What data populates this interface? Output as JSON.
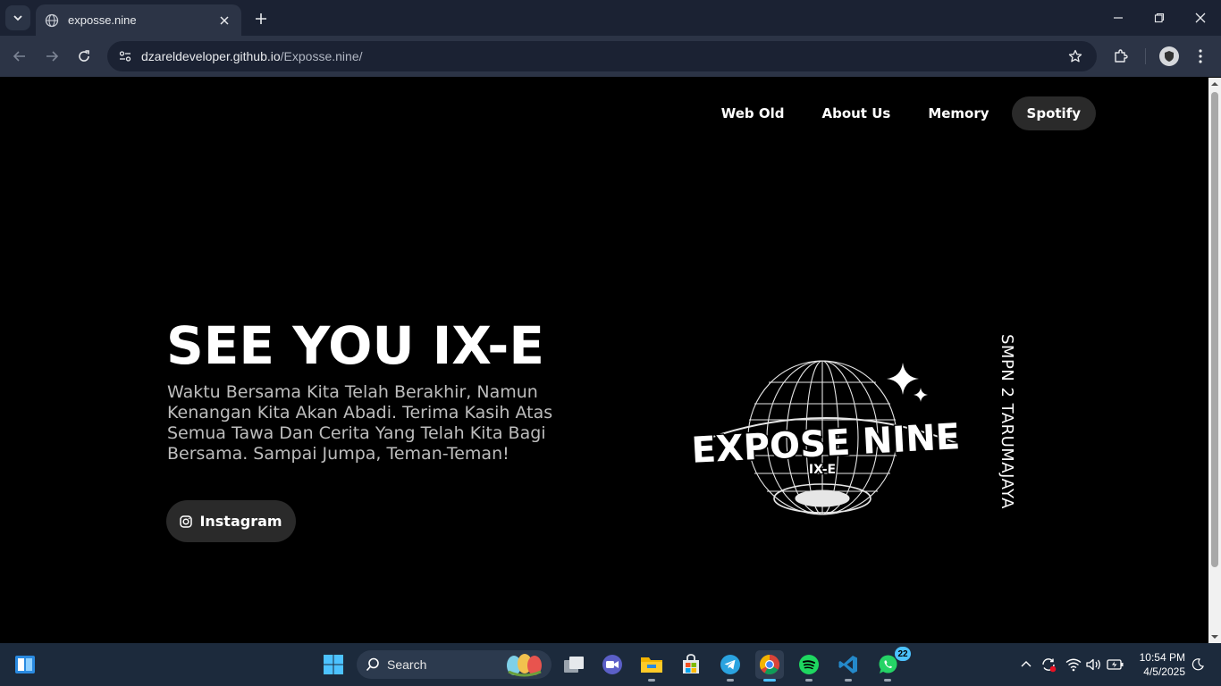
{
  "browser": {
    "tab_title": "exposse.nine",
    "url_host": "dzareldeveloper.github.io",
    "url_path": "/Exposse.nine/"
  },
  "nav": {
    "items": [
      "Web Old",
      "About Us",
      "Memory",
      "Spotify"
    ],
    "active": "Spotify"
  },
  "hero": {
    "title": "SEE YOU IX-E",
    "text": "Waktu Bersama Kita Telah Berakhir, Namun Kenangan Kita Akan Abadi. Terima Kasih Atas Semua Tawa Dan Cerita Yang Telah Kita Bagi Bersama. Sampai Jumpa, Teman-Teman!",
    "button_label": "Instagram"
  },
  "logo": {
    "main_text": "EXPOSE NINE",
    "sub_text": "IX-E"
  },
  "side_text": "SMPN 2 TARUMAJAYA",
  "taskbar": {
    "search_label": "Search",
    "whatsapp_badge": "22",
    "time": "10:54 PM",
    "date": "4/5/2025"
  },
  "colors": {
    "page_bg": "#000000",
    "chrome_dark": "#1b2233",
    "chrome_toolbar": "#2c3446",
    "button_bg": "#2a2a2a",
    "taskbar_bg": "#1c2a3c",
    "accent_blue": "#4cc2ff"
  }
}
